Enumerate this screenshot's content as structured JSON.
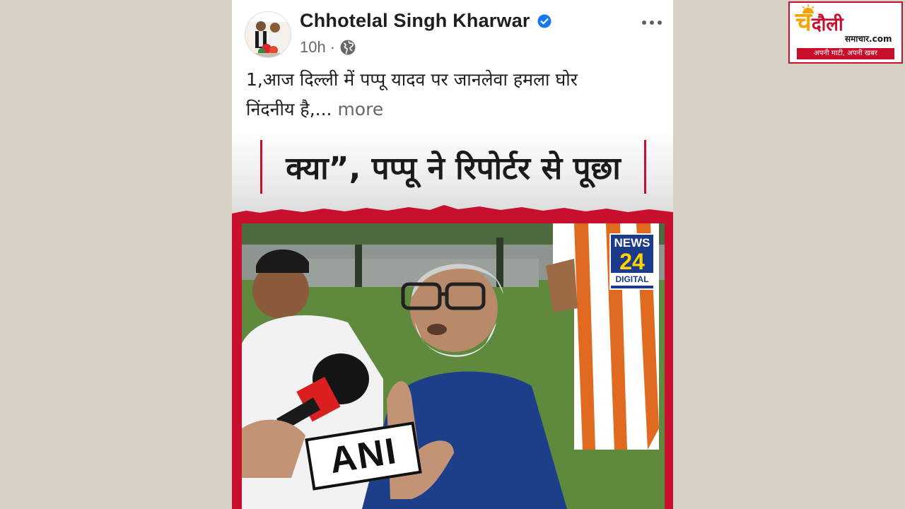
{
  "post": {
    "author": "Chhotelal Singh Kharwar",
    "time": "10h",
    "separator": "·",
    "text_line1": "1,आज दिल्ली में पप्पू यादव  पर जानलेवा हमला घोर",
    "text_line2": "निंदनीय है,...",
    "see_more": "more"
  },
  "media": {
    "headline": "क्या”, पप्पू ने रिपोर्टर से पूछा",
    "channel": {
      "line1": "NEWS",
      "line2": "24",
      "line3": "DIGITAL"
    },
    "mic_tag": "ANI"
  },
  "site_logo": {
    "first_letter": "चं",
    "rest": "दौली",
    "domain": "समाचार.com",
    "tagline": "अपनी माटी, अपनी खबर"
  },
  "icons": {
    "verified": "verified-badge-icon",
    "globe": "globe-icon",
    "more": "more-options-icon"
  },
  "colors": {
    "facebook_blue": "#1877f2",
    "accent_red": "#c8102e",
    "background": "#d6d1c4"
  }
}
